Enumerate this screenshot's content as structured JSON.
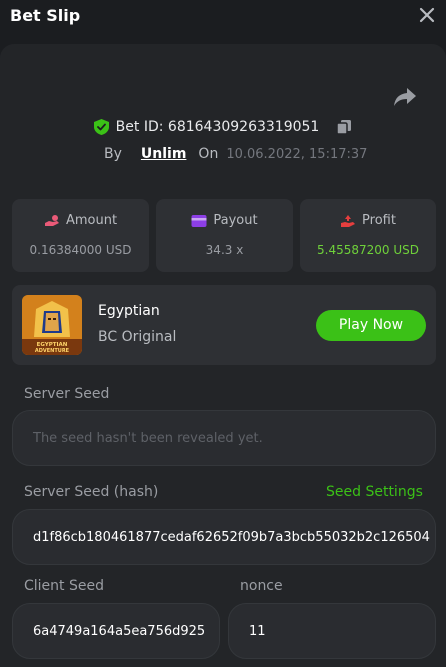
{
  "header": {
    "title": "Bet Slip"
  },
  "bet": {
    "id_label": "Bet ID: 68164309263319051",
    "by_label": "By",
    "user": "Unlim",
    "on_label": "On",
    "date": "10.06.2022, 15:17:37"
  },
  "stats": [
    {
      "label": "Amount",
      "value": "0.16384000 USD",
      "icon": "coins-hand-icon",
      "color": "#ea5a78"
    },
    {
      "label": "Payout",
      "value": "34.3 x",
      "icon": "card-icon",
      "color": "#8c3ee6"
    },
    {
      "label": "Profit",
      "value": "5.45587200 USD",
      "icon": "profit-hand-icon",
      "color": "#e63e3e",
      "value_color": "#6fd13a"
    }
  ],
  "game": {
    "name": "Egyptian",
    "provider": "BC Original",
    "play_label": "Play Now",
    "thumb_text": "EGYPTIAN ADVENTURE"
  },
  "seeds": {
    "server_label": "Server Seed",
    "server_value": "The seed hasn't been revealed yet.",
    "hash_label": "Server Seed (hash)",
    "settings_label": "Seed Settings",
    "hash_value": "d1f86cb180461877cedaf62652f09b7a3bcb55032b2c126504",
    "client_label": "Client Seed",
    "client_value": "6a4749a164a5ea756d925",
    "nonce_label": "nonce",
    "nonce_value": "11"
  },
  "colors": {
    "accent": "#3bc117",
    "verified": "#3bc117"
  }
}
